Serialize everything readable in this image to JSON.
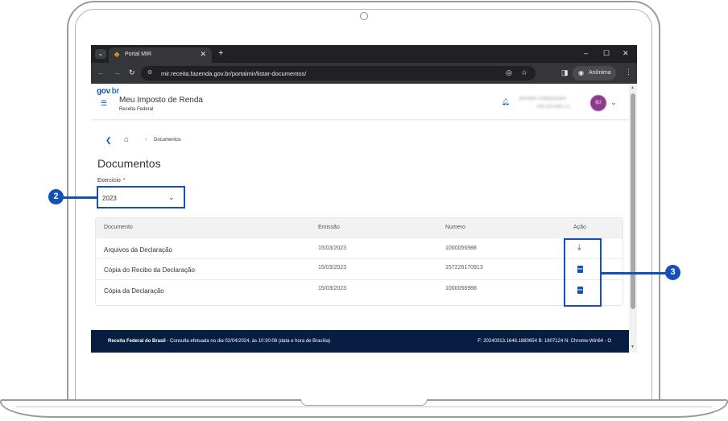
{
  "browser": {
    "tab_title": "Portal MIR",
    "new_tab": "+",
    "url": "mir.receita.fazenda.gov.br/portalmir/listar-documentos/",
    "incognito_label": "Anônima"
  },
  "header": {
    "logo": "gov.br",
    "app_title": "Meu Imposto de Renda",
    "app_subtitle": "Receita Federal",
    "user_name": "BRUNO JUNQUEIRA",
    "user_cpf": "048.804.980-22",
    "avatar_initials": "BJ"
  },
  "breadcrumb": {
    "current": "Documentos"
  },
  "page": {
    "title": "Documentos",
    "field_label": "Exercício",
    "required_mark": "*",
    "selected_year": "2023"
  },
  "table": {
    "headers": [
      "Documento",
      "Emissão",
      "Numero",
      "Ação"
    ],
    "rows": [
      {
        "documento": "Arquivos da Declaração",
        "emissao": "15/03/2023",
        "numero": "1000056988",
        "acao": "download-icon"
      },
      {
        "documento": "Cópia do Recibo da Declaração",
        "emissao": "15/03/2023",
        "numero": "157226170913",
        "acao": "pdf-icon"
      },
      {
        "documento": "Cópia da Declaração",
        "emissao": "15/03/2023",
        "numero": "1000056988",
        "acao": "pdf-icon"
      }
    ],
    "pdf_glyph": "PDF"
  },
  "footer": {
    "org": "Receita Federal do Brasil",
    "consult_text": " - Consulta efetuada no dia 02/04/2024, às 10:30:08 (data e hora de Brasília)",
    "build_info": "F: 20240313.1646.1880654 B: 1907124 N: Chrome-Win64 - O"
  },
  "callouts": {
    "first": "2",
    "second": "3"
  },
  "colors": {
    "brand_blue": "#1351b4",
    "footer_navy": "#071d41",
    "chrome_dark": "#202124",
    "required_red": "#e52207"
  }
}
